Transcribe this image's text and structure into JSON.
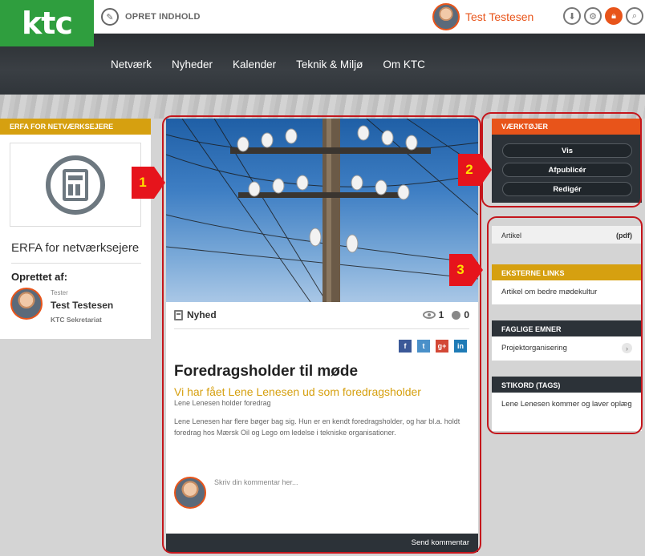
{
  "header": {
    "logo_text": "ktc",
    "create_label": "OPRET INDHOLD",
    "user_name": "Test Testesen",
    "tool_icons": [
      "download-icon",
      "gear-icon",
      "lock-icon",
      "search-icon"
    ]
  },
  "nav": {
    "items": [
      "Netværk",
      "Nyheder",
      "Kalender",
      "Teknik & Miljø",
      "Om KTC"
    ]
  },
  "group": {
    "header": "ERFA FOR NETVÆRKSEJERE",
    "title": "ERFA for netværksejere",
    "created_by_label": "Oprettet af:",
    "creator_role": "Tester",
    "creator_name": "Test Testesen",
    "creator_org": "KTC Sekretariat"
  },
  "article": {
    "type": "Nyhed",
    "views": "1",
    "comments": "0",
    "social": [
      "f",
      "t",
      "g+",
      "in"
    ],
    "title": "Foredragsholder til møde",
    "subtitle": "Vi har fået Lene Lenesen ud som foredragsholder",
    "byline": "Lene Lenesen holder foredrag",
    "body": "Lene Lenesen har flere bøger bag sig. Hun er en kendt foredragsholder, og har bl.a. holdt foredrag hos Mærsk Oil og Lego om ledelse i tekniske organisationer.",
    "comment_placeholder": "Skriv din kommentar her...",
    "send_label": "Send kommentar"
  },
  "tools": {
    "header": "VÆRKTØJER",
    "buttons": [
      "Vis",
      "Afpublicér",
      "Redigér"
    ]
  },
  "attachment": {
    "label": "Artikel",
    "format": "(pdf)"
  },
  "external_links": {
    "header": "EKSTERNE LINKS",
    "items": [
      "Artikel om bedre mødekultur"
    ]
  },
  "subjects": {
    "header": "FAGLIGE EMNER",
    "items": [
      "Projektorganisering"
    ]
  },
  "tags": {
    "header": "STIKORD (TAGS)",
    "items": [
      "Lene Lenesen kommer og laver oplæg"
    ]
  },
  "callouts": [
    "1",
    "2",
    "3"
  ],
  "colors": {
    "brand_green": "#2f9e3e",
    "accent_orange": "#e8541a",
    "gold": "#d6a010",
    "dark": "#2c3238",
    "annotation_red": "#e6141c"
  }
}
